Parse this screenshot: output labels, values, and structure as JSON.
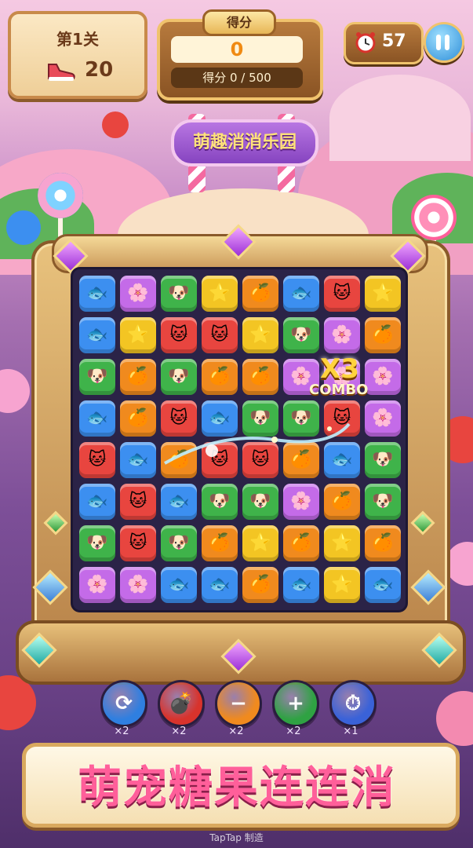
{
  "hud": {
    "level_label": "第1关",
    "moves": "20",
    "score_title": "得分",
    "score_value": "0",
    "score_goal": "得分 0 / 500",
    "timer": "57"
  },
  "park_sign": "萌趣消消乐园",
  "combo": {
    "multiplier": "X3",
    "label": "COMBO"
  },
  "board": {
    "rows": [
      [
        "fish",
        "flower",
        "dog",
        "star",
        "orange",
        "fish",
        "cat",
        "star"
      ],
      [
        "fish",
        "star",
        "cat",
        "cat",
        "star",
        "dog",
        "flower",
        "orange"
      ],
      [
        "dog",
        "orange",
        "dog",
        "orange",
        "orange",
        "flower",
        "flower",
        "flower"
      ],
      [
        "fish",
        "orange",
        "cat",
        "fish",
        "dog",
        "dog",
        "cat",
        "flower"
      ],
      [
        "cat",
        "fish",
        "orange",
        "cat",
        "cat",
        "orange",
        "fish",
        "dog"
      ],
      [
        "fish",
        "cat",
        "fish",
        "dog",
        "dog",
        "flower",
        "orange",
        "dog"
      ],
      [
        "dog",
        "cat",
        "dog",
        "orange",
        "star",
        "orange",
        "star",
        "orange"
      ],
      [
        "flower",
        "flower",
        "fish",
        "fish",
        "orange",
        "fish",
        "star",
        "fish"
      ]
    ],
    "tile_colors": {
      "fish": "#3c8ff0",
      "flower": "#c46be8",
      "dog": "#3fb34a",
      "star": "#f3c523",
      "orange": "#f08a1e",
      "cat": "#e8453f"
    },
    "tile_icons": {
      "fish": "🐟",
      "flower": "🌸",
      "dog": "🐶",
      "star": "⭐",
      "orange": "🍊",
      "cat": "🐱"
    }
  },
  "tools": [
    {
      "icon": "refresh-icon",
      "glyph": "⟳",
      "count": "×2",
      "color": "#2f7fe0"
    },
    {
      "icon": "bomb-icon",
      "glyph": "💣",
      "count": "×2",
      "color": "#d8332c"
    },
    {
      "icon": "minus-icon",
      "glyph": "−",
      "count": "×2",
      "color": "#f08a1e"
    },
    {
      "icon": "plus-icon",
      "glyph": "+",
      "count": "×2",
      "color": "#2fa243"
    },
    {
      "icon": "stopwatch-icon",
      "glyph": "⏱",
      "count": "×1",
      "color": "#3a62d8"
    }
  ],
  "banner": "萌宠糖果连连消",
  "watermark": "TapTap 制造"
}
